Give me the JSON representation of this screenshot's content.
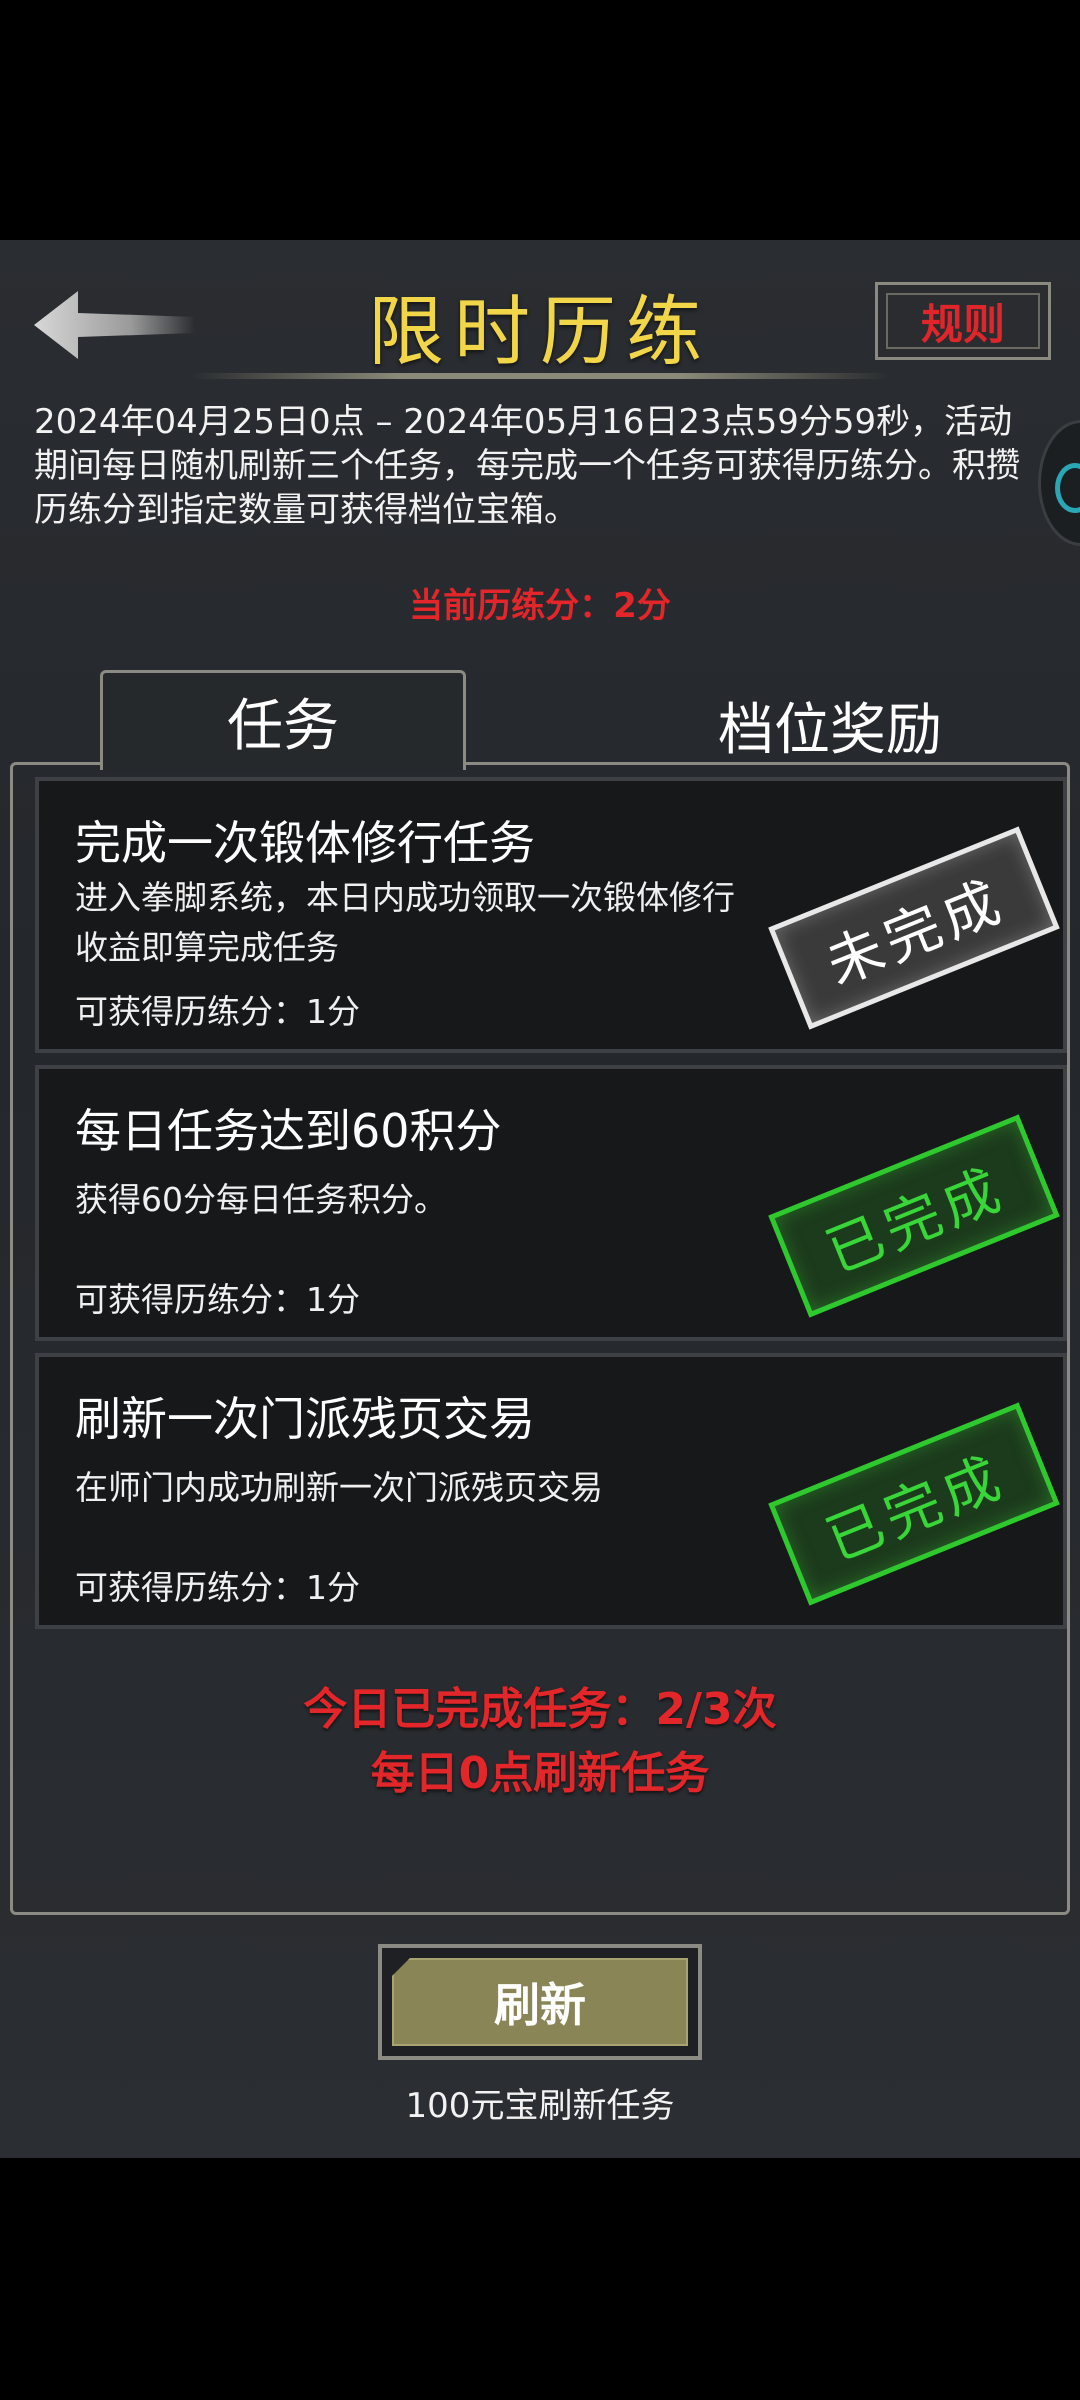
{
  "header": {
    "title": "限时历练",
    "rules_label": "规则"
  },
  "description": "2024年04月25日0点 – 2024年05月16日23点59分59秒，活动期间每日随机刷新三个任务，每完成一个任务可获得历练分。积攒历练分到指定数量可获得档位宝箱。",
  "current_score": "当前历练分：2分",
  "tabs": [
    {
      "label": "任务",
      "active": true
    },
    {
      "label": "档位奖励",
      "active": false
    }
  ],
  "tasks": [
    {
      "title": "完成一次锻体修行任务",
      "desc": "进入拳脚系统，本日内成功领取一次锻体修行收益即算完成任务",
      "points": "可获得历练分：1分",
      "status": "未完成"
    },
    {
      "title": "每日任务达到60积分",
      "desc": "获得60分每日任务积分。",
      "points": "可获得历练分：1分",
      "status": "已完成"
    },
    {
      "title": "刷新一次门派残页交易",
      "desc": "在师门内成功刷新一次门派残页交易",
      "points": "可获得历练分：1分",
      "status": "已完成"
    }
  ],
  "daily": {
    "completed": "今日已完成任务：2/3次",
    "refresh_note": "每日0点刷新任务"
  },
  "refresh": {
    "label": "刷新",
    "cost": "100元宝刷新任务"
  },
  "colors": {
    "title": "#f2d64a",
    "alert_red": "#e3262a",
    "done_green": "#39d639",
    "button_olive": "#8a8557"
  }
}
